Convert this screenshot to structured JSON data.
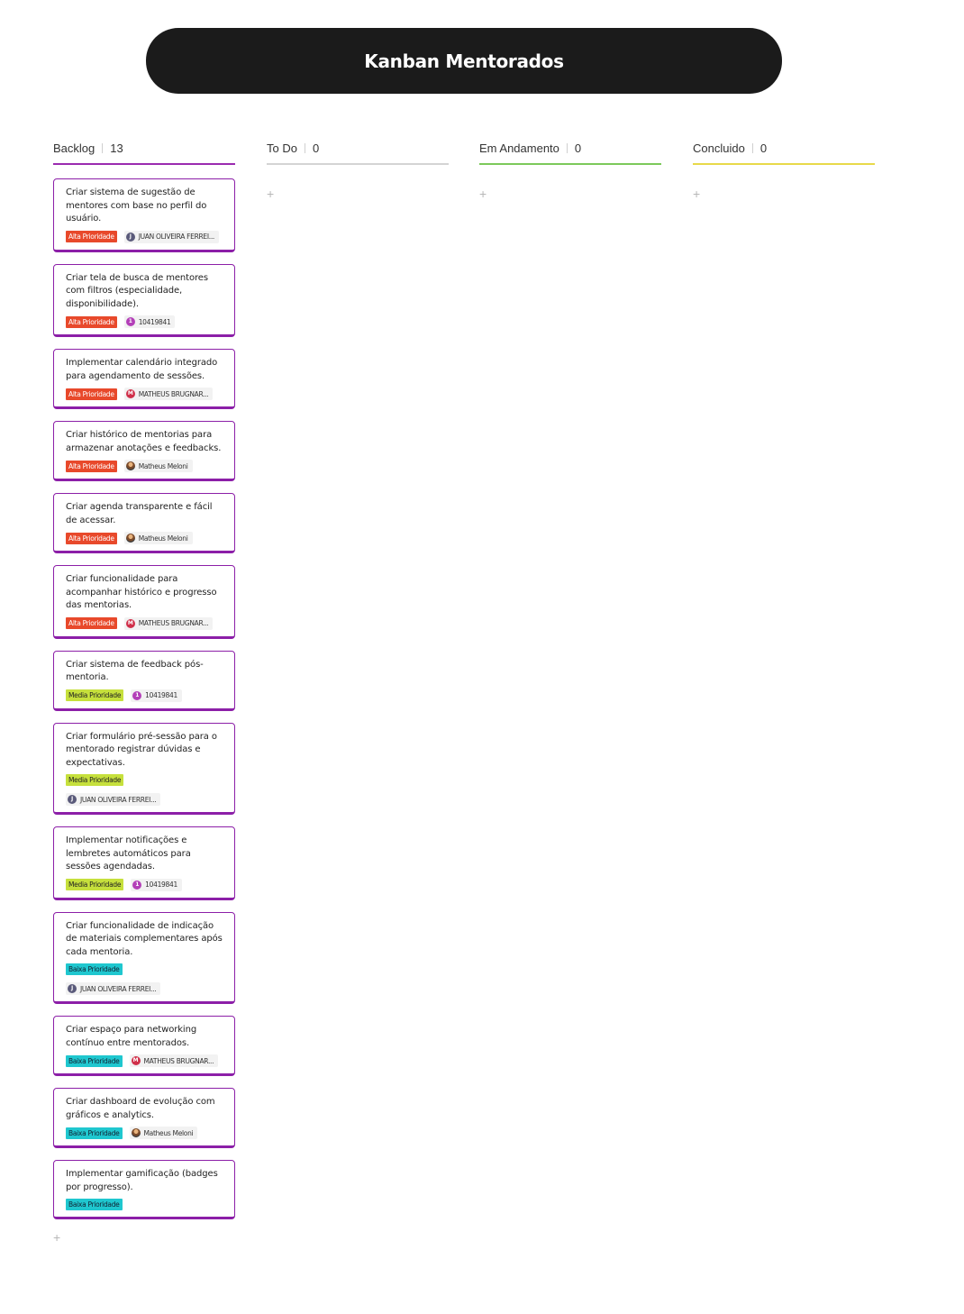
{
  "app": {
    "title": "Kanban Mentorados"
  },
  "columns": [
    {
      "name": "Backlog",
      "count": "13",
      "accent": "#9b2bb0"
    },
    {
      "name": "To Do",
      "count": "0",
      "accent": "#cfcfcf"
    },
    {
      "name": "Em Andamento",
      "count": "0",
      "accent": "#7cc95a"
    },
    {
      "name": "Concluido",
      "count": "0",
      "accent": "#e8d94a"
    }
  ],
  "add_icon": "+",
  "backlog_cards": [
    {
      "text": "Criar sistema de sugestão de mentores com base no perfil do usuário.",
      "priority": "Alta Prioridade",
      "level": "alta",
      "assignee": "JUAN OLIVEIRA FERREI...",
      "avatar_letter": "J",
      "avatar_color": "#5a5a7a"
    },
    {
      "text": "Criar tela de busca de mentores com filtros (especialidade, disponibilidade).",
      "priority": "Alta Prioridade",
      "level": "alta",
      "assignee": "10419841",
      "avatar_letter": "1",
      "avatar_color": "#b33fb8"
    },
    {
      "text": "Implementar calendário integrado para agendamento de sessões.",
      "priority": "Alta Prioridade",
      "level": "alta",
      "assignee": "MATHEUS BRUGNAR...",
      "avatar_letter": "M",
      "avatar_color": "#d0304a"
    },
    {
      "text": "Criar histórico de mentorias para armazenar anotações e feedbacks.",
      "priority": "Alta Prioridade",
      "level": "alta",
      "assignee": "Matheus Meloni",
      "avatar_letter": "",
      "avatar_color": "photo"
    },
    {
      "text": "Criar agenda transparente e fácil de acessar.",
      "priority": "Alta Prioridade",
      "level": "alta",
      "assignee": "Matheus Meloni",
      "avatar_letter": "",
      "avatar_color": "photo"
    },
    {
      "text": "Criar funcionalidade para acompanhar histórico e progresso das mentorias.",
      "priority": "Alta Prioridade",
      "level": "alta",
      "assignee": "MATHEUS BRUGNAR...",
      "avatar_letter": "M",
      "avatar_color": "#d0304a"
    },
    {
      "text": "Criar sistema de feedback pós-mentoria.",
      "priority": "Media Prioridade",
      "level": "media",
      "assignee": "10419841",
      "avatar_letter": "1",
      "avatar_color": "#b33fb8"
    },
    {
      "text": "Criar formulário pré-sessão para o mentorado registrar dúvidas e expectativas.",
      "priority": "Media Prioridade",
      "level": "media",
      "assignee": "JUAN OLIVEIRA FERREI...",
      "avatar_letter": "J",
      "avatar_color": "#5a5a7a"
    },
    {
      "text": "Implementar notificações e lembretes automáticos para sessões agendadas.",
      "priority": "Media Prioridade",
      "level": "media",
      "assignee": "10419841",
      "avatar_letter": "1",
      "avatar_color": "#b33fb8"
    },
    {
      "text": "Criar funcionalidade de indicação de materiais complementares após cada mentoria.",
      "priority": "Baixa Prioridade",
      "level": "baixa",
      "assignee": "JUAN OLIVEIRA FERREI...",
      "avatar_letter": "J",
      "avatar_color": "#5a5a7a"
    },
    {
      "text": "Criar espaço para networking contínuo entre mentorados.",
      "priority": "Baixa Prioridade",
      "level": "baixa",
      "assignee": "MATHEUS BRUGNAR...",
      "avatar_letter": "M",
      "avatar_color": "#d0304a"
    },
    {
      "text": "Criar dashboard de evolução com gráficos e analytics.",
      "priority": "Baixa Prioridade",
      "level": "baixa",
      "assignee": "Matheus Meloni",
      "avatar_letter": "",
      "avatar_color": "photo"
    },
    {
      "text": "Implementar gamificação (badges por progresso).",
      "priority": "Baixa Prioridade",
      "level": "baixa",
      "assignee": "",
      "avatar_letter": "",
      "avatar_color": ""
    }
  ]
}
